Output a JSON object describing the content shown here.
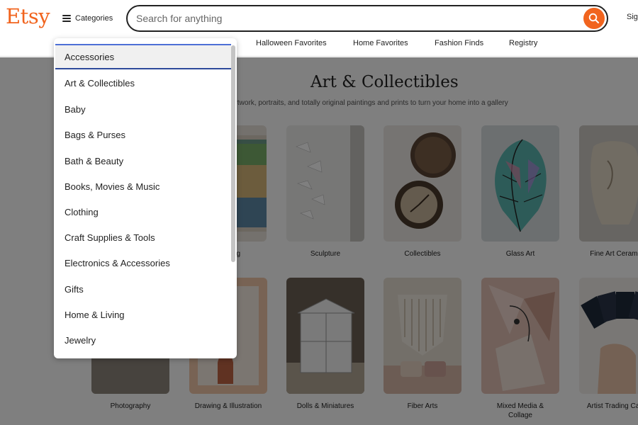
{
  "header": {
    "logo": "Etsy",
    "categories_label": "Categories",
    "search_placeholder": "Search for anything",
    "sign_in": "Sign in"
  },
  "subnav": [
    "Halloween Favorites",
    "Home Favorites",
    "Fashion Finds",
    "Registry"
  ],
  "page": {
    "title": "Art & Collectibles",
    "subtitle": "artwork, portraits, and totally original paintings and prints to turn your home into a gallery"
  },
  "cards_row1": [
    {
      "label": "Painting"
    },
    {
      "label": "Sculpture"
    },
    {
      "label": "Collectibles"
    },
    {
      "label": "Glass Art"
    },
    {
      "label": "Fine Art Ceramics"
    }
  ],
  "cards_row2": [
    {
      "label": "Photography"
    },
    {
      "label": "Drawing & Illustration"
    },
    {
      "label": "Dolls & Miniatures"
    },
    {
      "label": "Fiber Arts"
    },
    {
      "label": "Mixed Media &\nCollage"
    },
    {
      "label": "Artist Trading Cards"
    }
  ],
  "dropdown": {
    "active_index": 0,
    "items": [
      "Accessories",
      "Art & Collectibles",
      "Baby",
      "Bags & Purses",
      "Bath & Beauty",
      "Books, Movies & Music",
      "Clothing",
      "Craft Supplies & Tools",
      "Electronics & Accessories",
      "Gifts",
      "Home & Living",
      "Jewelry"
    ]
  },
  "colors": {
    "brand": "#f1641e",
    "focus_ring": "#3b5bdb"
  }
}
